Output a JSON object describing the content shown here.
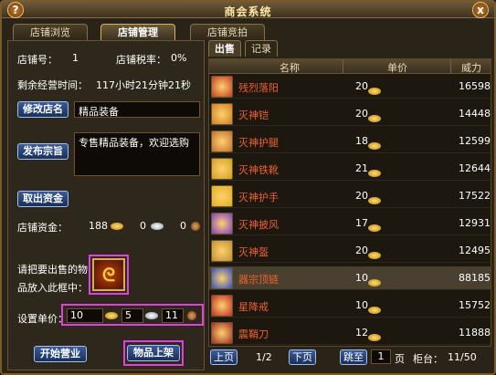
{
  "title": "商会系统",
  "help_label": "?",
  "close_label": "x",
  "tabs": [
    "店铺浏览",
    "店铺管理",
    "店铺竞拍"
  ],
  "shop": {
    "shop_no_label": "店铺号：",
    "shop_no": "1",
    "tax_label": "店铺税率：",
    "tax": "0%",
    "remain_label": "剩余经营时间：",
    "remain": "117小时21分钟21秒",
    "rename_button": "修改店名",
    "name_value": "精品装备",
    "motto_button": "发布宗旨",
    "motto_value": "专售精品装备，欢迎选购",
    "withdraw_button": "取出资金",
    "funds_label": "店铺资金：",
    "funds_gold": "188",
    "funds_silver": "0",
    "funds_copper": "0",
    "drop_hint_1": "请把要出售的物",
    "drop_hint_2": "品放入此框中：",
    "price_label": "设置单价：",
    "price_gold": "10",
    "price_silver": "5",
    "price_copper": "11",
    "open_button": "开始营业",
    "list_button": "物品上架"
  },
  "right_tabs": [
    "出售",
    "记录"
  ],
  "grid_headers": {
    "name": "名称",
    "price": "单价",
    "power": "威力"
  },
  "items": [
    {
      "name": "残烈落阳",
      "price": "20",
      "power": "16598",
      "icon_color": "#c04020",
      "selected": false
    },
    {
      "name": "灭神铠",
      "price": "20",
      "power": "14448",
      "icon_color": "#d08020",
      "selected": false
    },
    {
      "name": "灭神护腿",
      "price": "18",
      "power": "12599",
      "icon_color": "#c07030",
      "selected": false
    },
    {
      "name": "灭神铁靴",
      "price": "21",
      "power": "12644",
      "icon_color": "#d0a020",
      "selected": false
    },
    {
      "name": "灭神护手",
      "price": "20",
      "power": "17522",
      "icon_color": "#e0b020",
      "selected": false
    },
    {
      "name": "灭神披风",
      "price": "17",
      "power": "12931",
      "icon_color": "#8040c0",
      "selected": false
    },
    {
      "name": "灭神盔",
      "price": "20",
      "power": "12495",
      "icon_color": "#c09030",
      "selected": false
    },
    {
      "name": "器宗顶链",
      "price": "10",
      "power": "88185",
      "icon_color": "#3050c0",
      "selected": true
    },
    {
      "name": "星降戒",
      "price": "10",
      "power": "15752",
      "icon_color": "#c03020",
      "selected": false
    },
    {
      "name": "震鞘刀",
      "price": "12",
      "power": "11888",
      "icon_color": "#a03020",
      "selected": false
    }
  ],
  "pager": {
    "prev": "上页",
    "page": "1/2",
    "next": "下页",
    "jump": "跳至",
    "jump_value": "1",
    "page_unit": "页",
    "counter_label": "柜台：",
    "counter_value": "11/50"
  },
  "icons": {
    "gold": "gold-coin-icon",
    "silver": "silver-ingot-icon",
    "copper": "copper-coin-icon"
  },
  "colors": {
    "highlight": "#e040e0",
    "item_name": "#f06030",
    "button": "#18305a"
  }
}
